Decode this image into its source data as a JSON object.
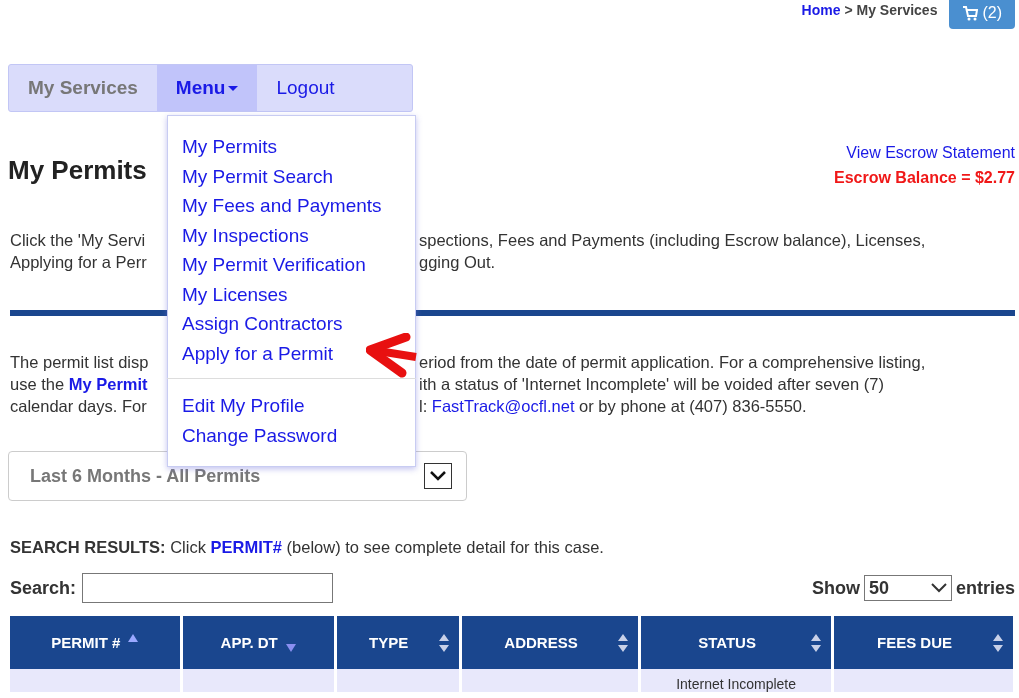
{
  "breadcrumb": {
    "home": "Home",
    "separator": ">",
    "current": "My Services"
  },
  "cart": {
    "count": "(2)"
  },
  "nav": [
    {
      "label": "My Services",
      "selected": false,
      "kind": "current"
    },
    {
      "label": "Menu",
      "selected": true,
      "kind": "dropdown"
    },
    {
      "label": "Logout",
      "selected": false,
      "kind": "link"
    }
  ],
  "menu": {
    "groups": [
      [
        "My Permits",
        "My Permit Search",
        "My Fees and Payments",
        "My Inspections",
        "My Permit Verification",
        "My Licenses",
        "Assign Contractors",
        "Apply for a Permit"
      ],
      [
        "Edit My Profile",
        "Change Password"
      ]
    ]
  },
  "title": "My Permits",
  "escrow": {
    "link": "View Escrow Statement",
    "balance": "Escrow Balance = $2.77"
  },
  "intro_lines": [
    {
      "left": "Click the 'My Servi",
      "right": "spections, Fees and Payments (including Escrow balance), Licenses,"
    },
    {
      "left": "Applying for a Perr",
      "right": "gging Out."
    }
  ],
  "notice_lines": [
    {
      "left": "The permit list disp",
      "right": "eriod from the date of permit application. For a comprehensive listing,"
    },
    {
      "left": "use the **My Permit**",
      "right": "ith a status of 'Internet Incomplete' will be voided after seven (7)"
    },
    {
      "left": "calendar days. For",
      "right_before": "l: ",
      "link": "FastTrack@ocfl.net",
      "right": " or by phone at (407) 836-5550."
    }
  ],
  "filter": {
    "value": "Last 6 Months - All Permits"
  },
  "results_note": {
    "label": "SEARCH RESULTS:",
    "before": " Click ",
    "link": "PERMIT#",
    "after": " (below) to see complete detail for this case."
  },
  "search": {
    "label": "Search:"
  },
  "show": {
    "before": "Show",
    "value": "50",
    "after": "entries"
  },
  "table": {
    "columns": [
      {
        "label": "PERMIT #",
        "sorted": true,
        "ascending": true
      },
      {
        "label": "APP. DT",
        "sorted": true,
        "ascending": false
      },
      {
        "label": "TYPE",
        "sorted": false
      },
      {
        "label": "ADDRESS",
        "sorted": false
      },
      {
        "label": "STATUS",
        "sorted": false
      },
      {
        "label": "FEES DUE",
        "sorted": false
      }
    ],
    "rows": [
      [
        "",
        "",
        "",
        "",
        "Internet Incomplete",
        ""
      ]
    ]
  }
}
